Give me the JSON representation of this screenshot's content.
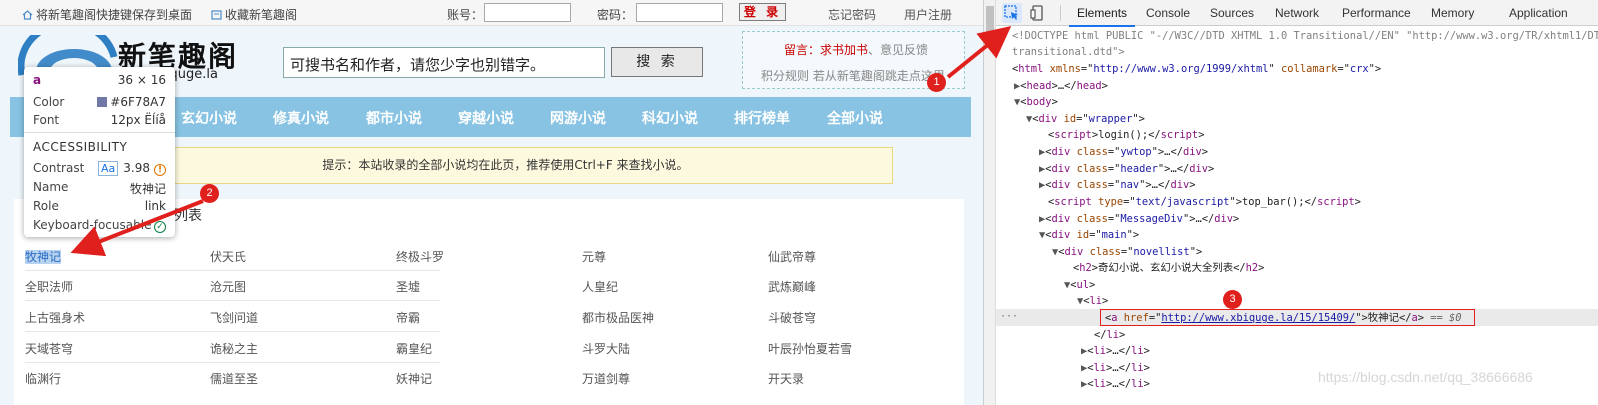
{
  "topbar": {
    "shortcut_link": "将新笔趣阁快捷键保存到桌面",
    "favorite_link": "收藏新笔趣阁",
    "account_label": "账号：",
    "password_label": "密码：",
    "login_button": "登 录",
    "forgot_link": "忘记密码",
    "register_link": "用户注册"
  },
  "header": {
    "logo_text": "新笔趣阁",
    "logo_domain": "xbiquge.la",
    "search_value": "可搜书名和作者，请您少字也别错字。",
    "search_button": "搜 索",
    "message_red": "留言：求书加书",
    "message_sep": "、意见反馈",
    "message_line2": "积分规则 若从新笔趣阁跳走点这里"
  },
  "nav": [
    "玄幻小说",
    "修真小说",
    "都市小说",
    "穿越小说",
    "网游小说",
    "科幻小说",
    "排行榜单",
    "全部小说"
  ],
  "tip": "提示：本站收录的全部小说均在此页，推荐使用Ctrl+F 来查找小说。",
  "novellist": {
    "title": "列表",
    "rows": [
      [
        "牧神记",
        "伏天氏",
        "终极斗罗",
        "元尊",
        "仙武帝尊"
      ],
      [
        "全职法师",
        "沧元图",
        "圣墟",
        "人皇纪",
        "武炼巅峰"
      ],
      [
        "上古强身术",
        "飞剑问道",
        "帝霸",
        "都市极品医神",
        "斗破苍穹"
      ],
      [
        "天域苍穹",
        "诡秘之主",
        "霸皇纪",
        "斗罗大陆",
        "叶辰孙怡夏若雪"
      ],
      [
        "临渊行",
        "儒道至圣",
        "妖神记",
        "万道剑尊",
        "开天录"
      ]
    ]
  },
  "tooltip": {
    "tag": "a",
    "size": "36 × 16",
    "color_label": "Color",
    "color_value": "#6F78A7",
    "font_label": "Font",
    "font_value": "12px Ëĺíå",
    "accessibility": "ACCESSIBILITY",
    "contrast_label": "Contrast",
    "contrast_aa": "Aa",
    "contrast_value": "3.98",
    "name_label": "Name",
    "name_value": "牧神记",
    "role_label": "Role",
    "role_value": "link",
    "kbd_label": "Keyboard-focusable"
  },
  "devtools": {
    "tabs": [
      "Elements",
      "Console",
      "Sources",
      "Network",
      "Performance",
      "Memory",
      "Application"
    ],
    "active_tab": "Elements",
    "dom": {
      "l1a": "<!DOCTYPE html PUBLIC \"-//W3C//DTD XHTML 1.0 Transitional//EN\" \"http://www.w3.org/TR/xhtml1/DTD/xhtml1-",
      "l1b": "transitional.dtd\">",
      "html_tag": "html",
      "xmlns_attr": "xmlns",
      "xmlns_val": "http://www.w3.org/1999/xhtml",
      "collamark_attr": "collamark",
      "collamark_val": "crx",
      "head": "head",
      "body": "body",
      "div": "div",
      "id_attr": "id",
      "class_attr": "class",
      "wrapper": "wrapper",
      "script": "script",
      "login_call": "login();",
      "ywtop": "ywtop",
      "header": "header",
      "nav": "nav",
      "type_attr": "type",
      "type_val": "text/javascript",
      "top_bar_call": "top_bar();",
      "messagediv": "MessageDiv",
      "main": "main",
      "novellist": "novellist",
      "h2": "h2",
      "h2_text": "奇幻小说、玄幻小说大全列表",
      "ul": "ul",
      "li": "li",
      "a": "a",
      "href_attr": "href",
      "href_val": "http://www.xbiquge.la/15/15409/",
      "a_text": "牧神记",
      "eq": " == $0",
      "ellipsis": "…",
      "dots": "···"
    }
  },
  "markers": [
    "1",
    "2",
    "3"
  ],
  "watermark": "https://blog.csdn.net/qq_38666686",
  "colors": {
    "nav": "#88c3e3",
    "accent": "#1a73e8",
    "annotation": "#e0201c",
    "link_color": "#6F78A7"
  }
}
